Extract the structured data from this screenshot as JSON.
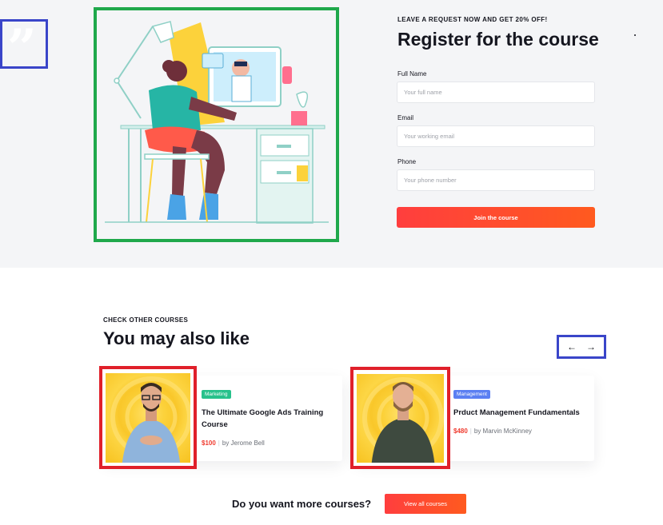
{
  "register": {
    "kicker": "LEAVE A REQUEST NOW AND GET 20% OFF!",
    "title": "Register for the course",
    "fields": [
      {
        "label": "Full Name",
        "placeholder": "Your full name"
      },
      {
        "label": "Email",
        "placeholder": "Your working email"
      },
      {
        "label": "Phone",
        "placeholder": "Your phone number"
      }
    ],
    "submit_label": "Join the course"
  },
  "related": {
    "kicker": "CHECK OTHER COURSES",
    "title": "You may also like",
    "prev_arrow": "←",
    "next_arrow": "→",
    "courses": [
      {
        "badge": "Marketing",
        "badge_color": "#27c18b",
        "title": "The Ultimate Google Ads Training Course",
        "price": "$100",
        "author": "by Jerome Bell"
      },
      {
        "badge": "Management",
        "badge_color": "#5b7ff2",
        "title": "Prduct Management Fundamentals",
        "price": "$480",
        "author": "by Marvin McKinney"
      }
    ]
  },
  "footer_cta": {
    "question": "Do you want more courses?",
    "button_label": "View all courses"
  },
  "colors": {
    "accent": "#ff4a2b",
    "quote_frame": "#3a45c9",
    "illustration_frame": "#1fa84b",
    "photo_frame": "#e0202a"
  }
}
